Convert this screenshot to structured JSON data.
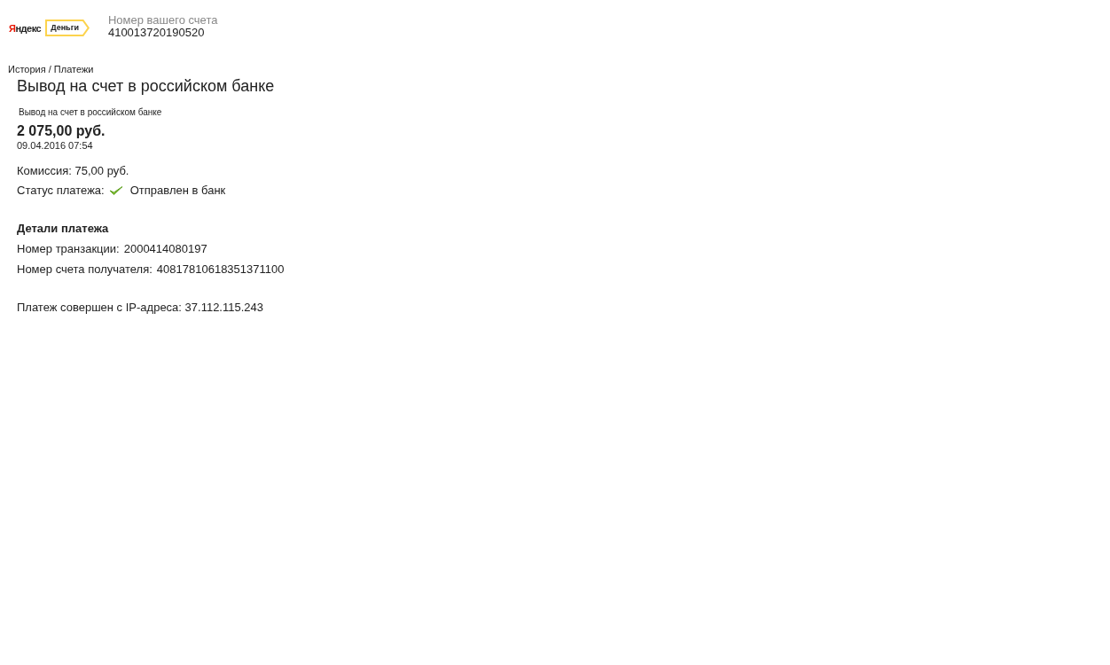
{
  "header": {
    "logo": {
      "brand": "Яндекс",
      "product": "Деньги"
    },
    "account_label": "Номер вашего счета",
    "account_number": "410013720190520"
  },
  "breadcrumb": "История / Платежи",
  "title": "Вывод на счет в российском банке",
  "payment": {
    "description": "Вывод на счет в российском банке",
    "amount": "2 075,00 руб.",
    "datetime": "09.04.2016 07:54",
    "commission": "Комиссия: 75,00 руб.",
    "status_label": "Статус платежа:",
    "status": "Отправлен в банк"
  },
  "details": {
    "heading": "Детали платежа",
    "rows": [
      {
        "label": "Номер транзакции:",
        "value": "2000414080197"
      },
      {
        "label": "Номер счета получателя:",
        "value": "40817810618351371100"
      }
    ]
  },
  "ip_note": "Платеж совершен с IP-адреса: 37.112.115.243"
}
